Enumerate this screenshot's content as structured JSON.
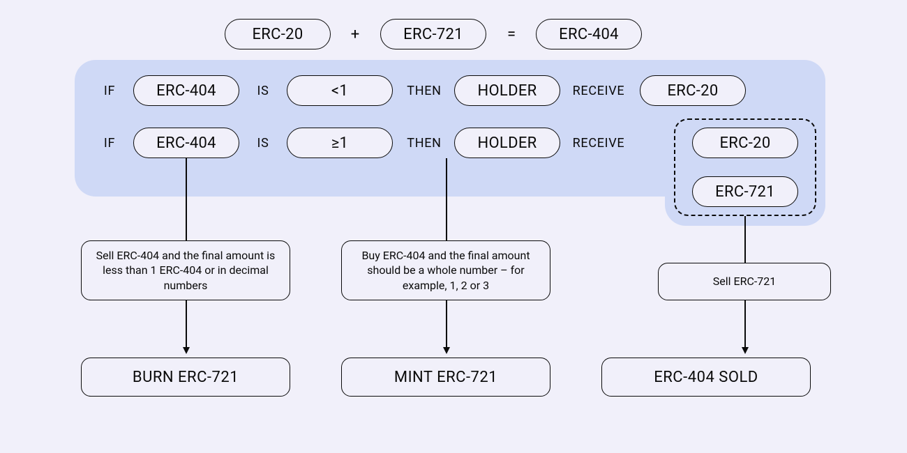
{
  "equation": {
    "left": "ERC-20",
    "plus": "+",
    "middle": "ERC-721",
    "equals": "=",
    "right": "ERC-404"
  },
  "rules": {
    "r1": {
      "if": "IF",
      "token": "ERC-404",
      "is": "IS",
      "cond": "<1",
      "then": "THEN",
      "subject": "HOLDER",
      "verb": "RECEIVE",
      "receive1": "ERC-20"
    },
    "r2": {
      "if": "IF",
      "token": "ERC-404",
      "is": "IS",
      "cond": "≥1",
      "then": "THEN",
      "subject": "HOLDER",
      "verb": "RECEIVE",
      "receive1": "ERC-20",
      "receive2": "ERC-721"
    }
  },
  "flows": {
    "left": {
      "desc": "Sell ERC-404 and the final amount is less than 1 ERC-404 or in decimal numbers",
      "result": "BURN ERC-721"
    },
    "mid": {
      "desc": "Buy ERC-404 and the final amount should be a whole number – for example, 1, 2 or 3",
      "result": "MINT ERC-721"
    },
    "right": {
      "desc": "Sell ERC-721",
      "result": "ERC-404 SOLD"
    }
  }
}
